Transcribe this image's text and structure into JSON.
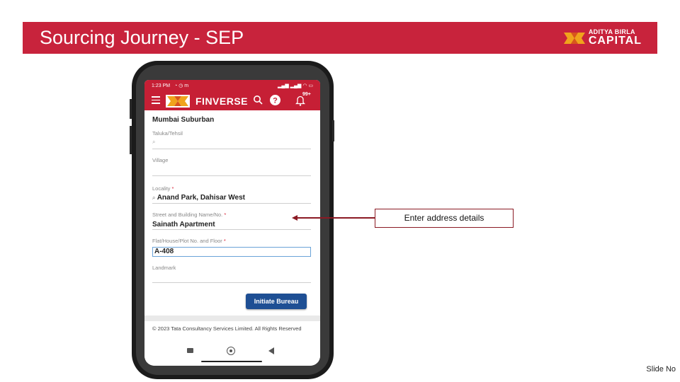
{
  "slide": {
    "title": "Sourcing Journey - SEP",
    "brand_top": "ADITYA BIRLA",
    "brand_bottom": "CAPITAL",
    "slide_no": "Slide No",
    "callout": "Enter address details",
    "accent_color": "#c8233c"
  },
  "phone": {
    "status_time": "1:23 PM",
    "status_icons": "ull ull wifi battery",
    "app_name": "FINVERSE",
    "notification_badge": "99+",
    "icons": [
      "menu-icon",
      "search-icon",
      "help-icon",
      "bell-icon"
    ]
  },
  "form": {
    "district_value": "Mumbai Suburban",
    "taluka_label": "Taluka/Tehsil",
    "village_label": "Village",
    "locality_label": "Locality",
    "locality_value": "Anand Park, Dahisar West",
    "street_label": "Street and Building Name/No.",
    "street_value": "Sainath Apartment",
    "flat_label": "Flat/House/Plot No. and Floor",
    "flat_value": "A-408",
    "landmark_label": "Landmark",
    "required_mark": "*",
    "submit_label": "Initiate Bureau"
  },
  "footer": {
    "copyright": "© 2023 Tata Consultancy Services Limited. All Rights Reserved"
  }
}
